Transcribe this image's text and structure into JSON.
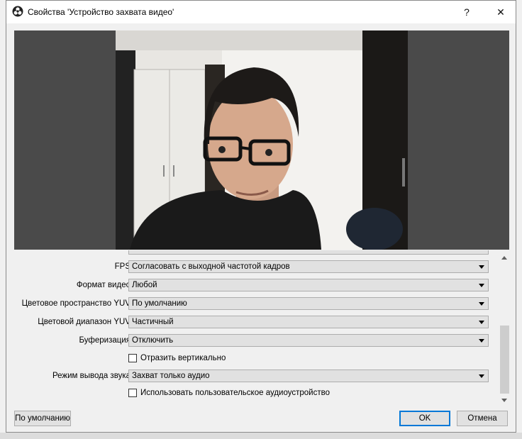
{
  "window": {
    "title": "Свойства 'Устройство захвата видео'",
    "help": "?",
    "close": "✕"
  },
  "form": {
    "fps": {
      "label": "FPS",
      "value": "Согласовать с выходной частотой кадров"
    },
    "video_format": {
      "label": "Формат видео",
      "value": "Любой"
    },
    "color_space": {
      "label": "Цветовое пространство YUV",
      "value": "По умолчанию"
    },
    "color_range": {
      "label": "Цветовой диапазон YUV",
      "value": "Частичный"
    },
    "buffering": {
      "label": "Буферизация",
      "value": "Отключить"
    },
    "flip_vertical": {
      "label": "Отразить вертикально",
      "checked": false
    },
    "audio_output_mode": {
      "label": "Режим вывода звука",
      "value": "Захват только аудио"
    },
    "custom_audio": {
      "label": "Использовать пользовательское аудиоустройство",
      "checked": false
    }
  },
  "buttons": {
    "defaults": "По умолчанию",
    "ok": "OK",
    "cancel": "Отмена"
  },
  "icons": {
    "app": "obs-logo-icon",
    "arrow": "chevron-down-icon"
  },
  "colors": {
    "accent": "#0078d7",
    "dialog_bg": "#f0f0f0",
    "preview_bg": "#4a4a4a"
  }
}
